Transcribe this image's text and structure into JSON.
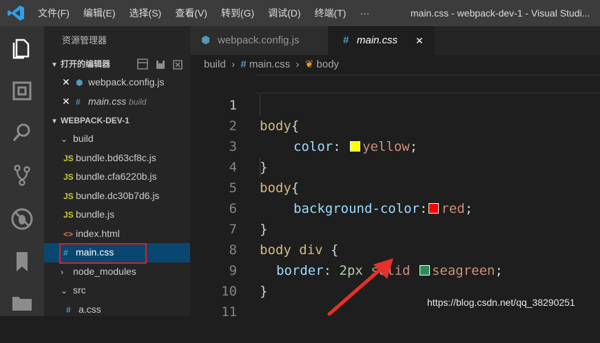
{
  "menu": [
    "文件(F)",
    "编辑(E)",
    "选择(S)",
    "查看(V)",
    "转到(G)",
    "调试(D)",
    "终端(T)",
    "···"
  ],
  "window_title": "main.css - webpack-dev-1 - Visual Studi...",
  "activity_icons": [
    "files-icon",
    "extensions-icon",
    "search-icon",
    "source-control-icon",
    "debug-icon",
    "bookmark-icon",
    "folder-icon"
  ],
  "sidebar": {
    "header": "资源管理器",
    "open_editors": {
      "title": "打开的编辑器",
      "items": [
        {
          "name": "webpack.config.js",
          "desc": ""
        },
        {
          "name": "main.css",
          "desc": "build"
        }
      ]
    },
    "project": {
      "title": "WEBPACK-DEV-1",
      "tree": [
        {
          "label": "build",
          "icon": "chevron-down"
        },
        {
          "label": "bundle.bd63cf8c.js",
          "icon": "JS"
        },
        {
          "label": "bundle.cfa6220b.js",
          "icon": "JS"
        },
        {
          "label": "bundle.dc30b7d6.js",
          "icon": "JS"
        },
        {
          "label": "bundle.js",
          "icon": "JS"
        },
        {
          "label": "index.html",
          "icon": "<>"
        },
        {
          "label": "main.css",
          "icon": "#"
        },
        {
          "label": "node_modules",
          "icon": "chevron-right"
        },
        {
          "label": "src",
          "icon": "chevron-down"
        },
        {
          "label": "a.css",
          "icon": "#"
        }
      ]
    }
  },
  "tabs": [
    {
      "label": "webpack.config.js",
      "icon": "cube-icon"
    },
    {
      "label": "main.css",
      "icon": "#"
    }
  ],
  "breadcrumb": [
    "build",
    "main.css",
    "body"
  ],
  "editor": {
    "line_numbers": [
      "1",
      "2",
      "3",
      "4",
      "5",
      "6",
      "7",
      "8",
      "9",
      "10",
      "11"
    ],
    "colors": {
      "yellow": "#ffff00",
      "red": "#ff0000",
      "seagreen": "#2e8b57"
    },
    "l1_sel": "body",
    "l1_brace": "{",
    "l2_prop": "color",
    "l2_colon": ": ",
    "l2_val": "yellow",
    "l2_semi": ";",
    "l3": "}",
    "l4_sel": "body",
    "l4_brace": "{",
    "l5_prop": "background-color",
    "l5_colon": ":",
    "l5_val": "red",
    "l5_semi": ";",
    "l6": "}",
    "l7_sel": "body div",
    "l7_brace": " {",
    "l8_prop": "border",
    "l8_colon": ": ",
    "l8_num": "2px",
    "l8_val1": " solid ",
    "l8_val2": "seagreen",
    "l8_semi": ";",
    "l9": "}"
  },
  "watermark": "https://blog.csdn.net/qq_38290251"
}
